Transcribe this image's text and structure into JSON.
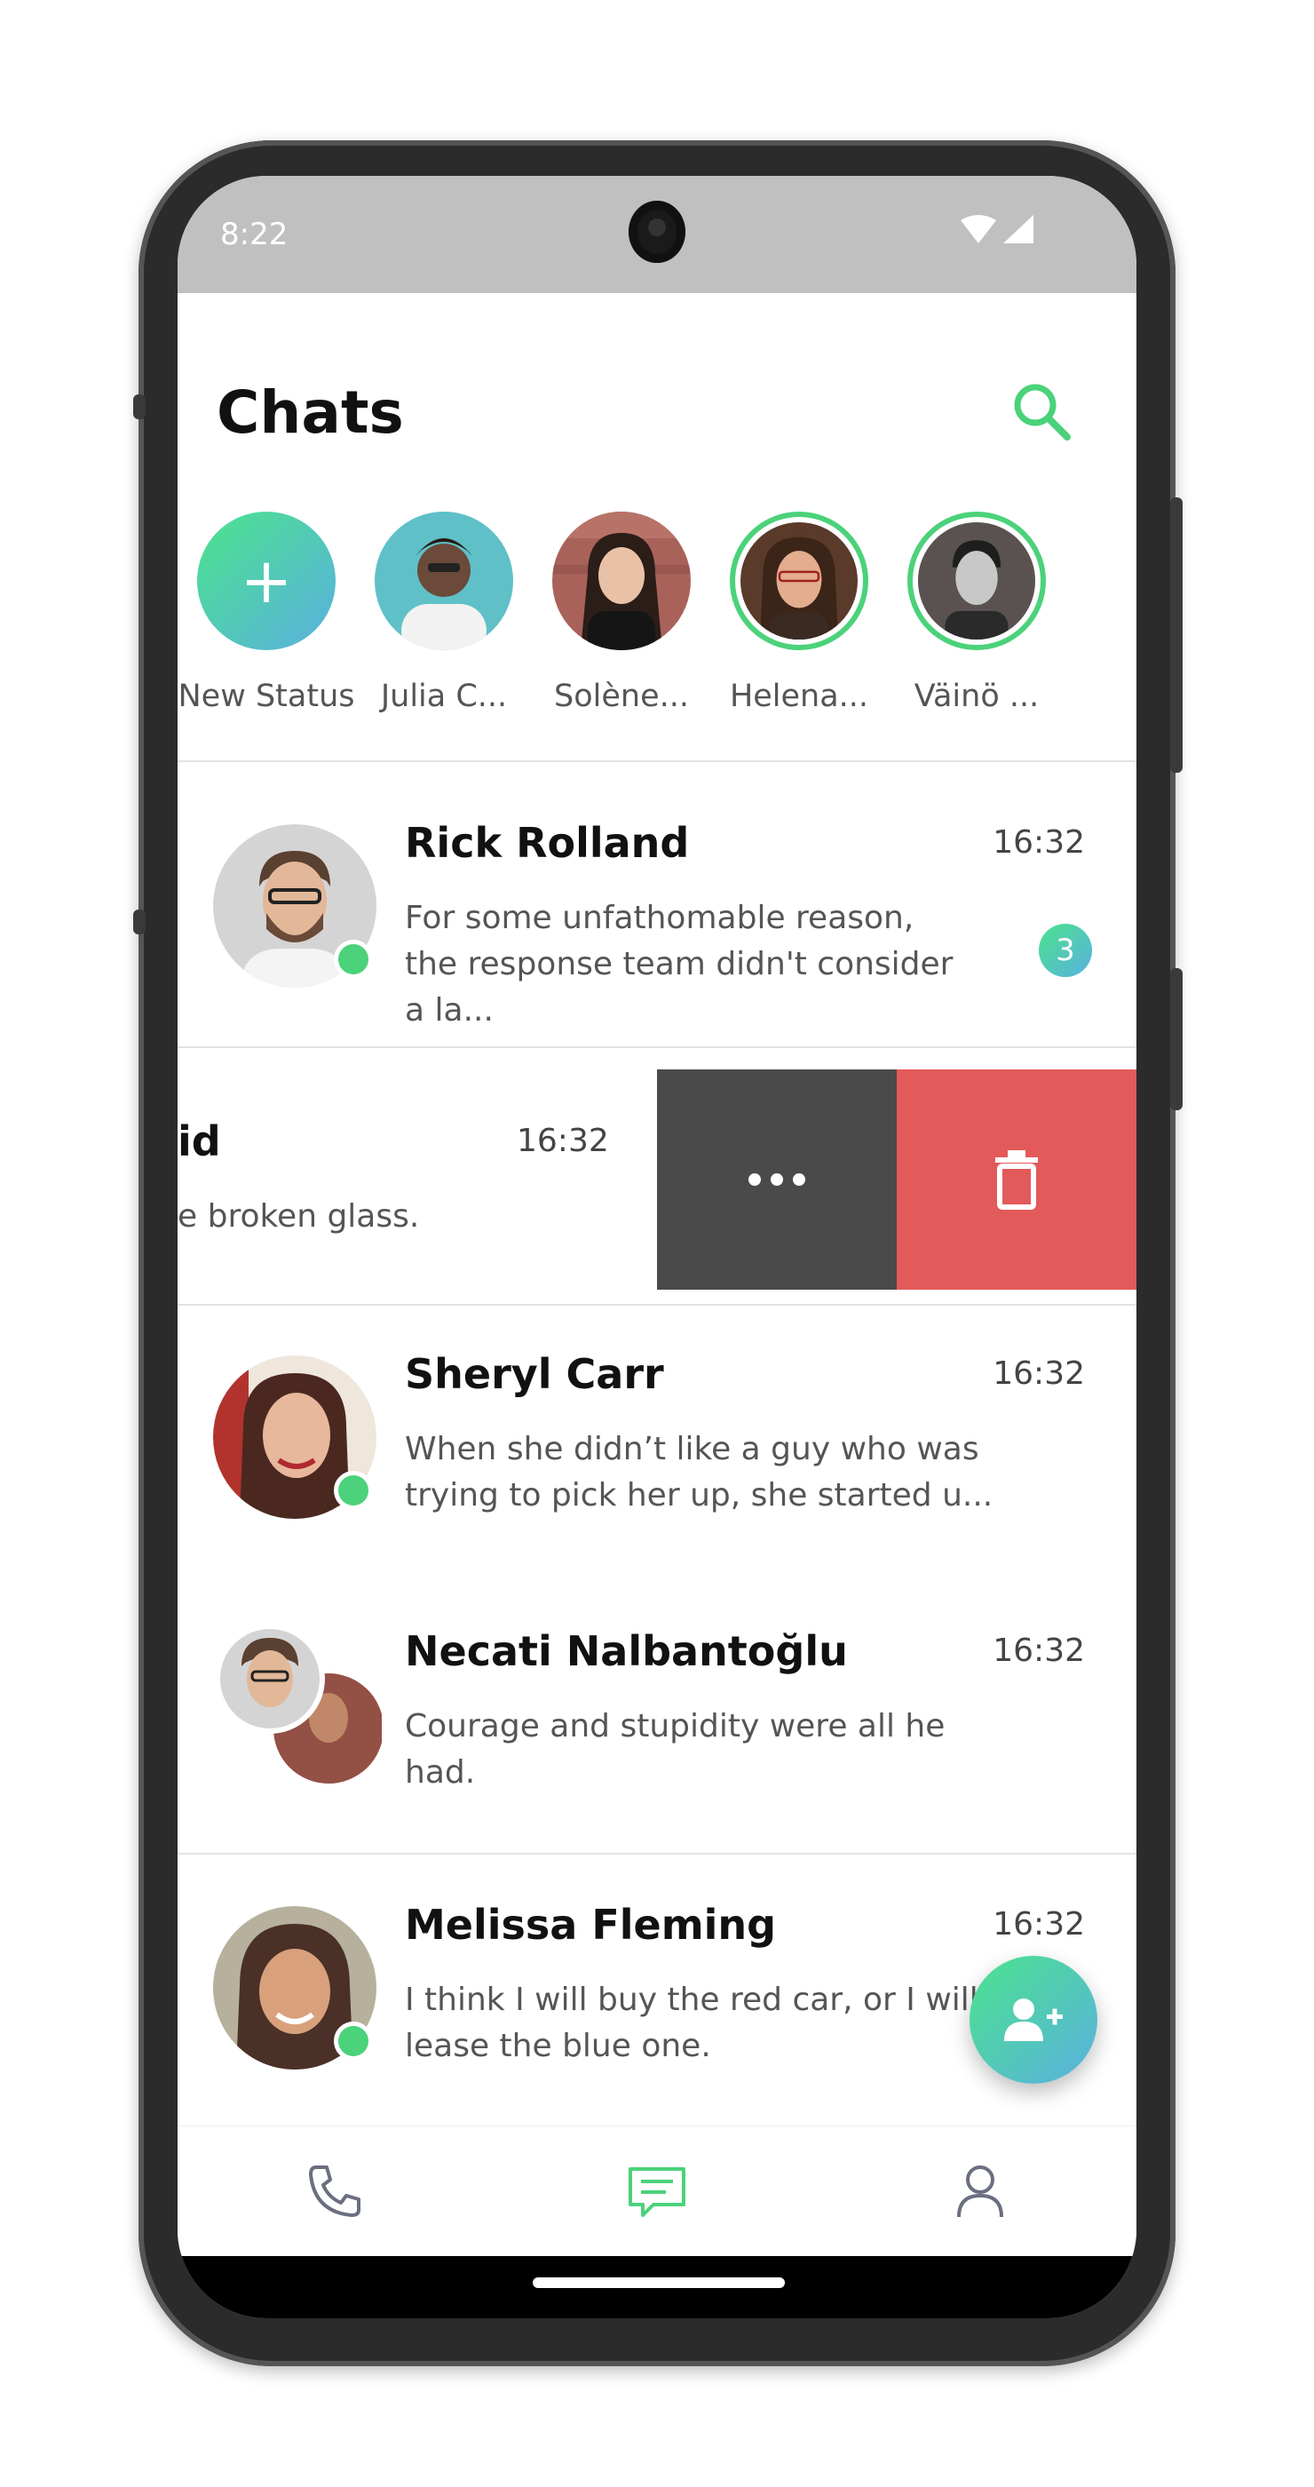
{
  "status_bar": {
    "time": "8:22"
  },
  "header": {
    "title": "Chats"
  },
  "statuses": [
    {
      "name": "New Status",
      "kind": "new"
    },
    {
      "name": "Julia C...",
      "kind": "avatar"
    },
    {
      "name": "Solène...",
      "kind": "avatar"
    },
    {
      "name": "Helena...",
      "kind": "avatar-ring"
    },
    {
      "name": "Väinö ...",
      "kind": "avatar-ring"
    }
  ],
  "chats": [
    {
      "name": "Rick Rolland",
      "time": "16:32",
      "message": "For some unfathomable reason, the response team didn't consider a la...",
      "unread": "3",
      "online": true
    },
    {
      "name_fragment": "id",
      "time": "16:32",
      "message_fragment": "e broken glass.",
      "swiped": true
    },
    {
      "name": "Sheryl Carr",
      "time": "16:32",
      "message": "When she didn’t like a guy who was trying to pick her up, she started u...",
      "online": true
    },
    {
      "name": "Necati Nalbantoğlu",
      "time": "16:32",
      "message": "Courage and stupidity were all he had.",
      "group": true
    },
    {
      "name": "Melissa Fleming",
      "time": "16:32",
      "message": "I think I will buy the red car, or I will lease the blue one.",
      "online": true
    }
  ],
  "swipe_actions": {
    "more_icon": "more-horizontal-icon",
    "delete_icon": "trash-icon"
  },
  "fab": {
    "icon": "add-user-icon"
  },
  "bottom_nav": [
    {
      "icon": "phone-icon",
      "active": false
    },
    {
      "icon": "chat-icon",
      "active": true
    },
    {
      "icon": "profile-icon",
      "active": false
    }
  ],
  "colors": {
    "accent": "#4bd27a",
    "gradient_start": "#4be38c",
    "gradient_end": "#5ab0e0",
    "delete": "#e35a5a",
    "more": "#4a4a4a",
    "status_bar": "#c0c0c0"
  }
}
